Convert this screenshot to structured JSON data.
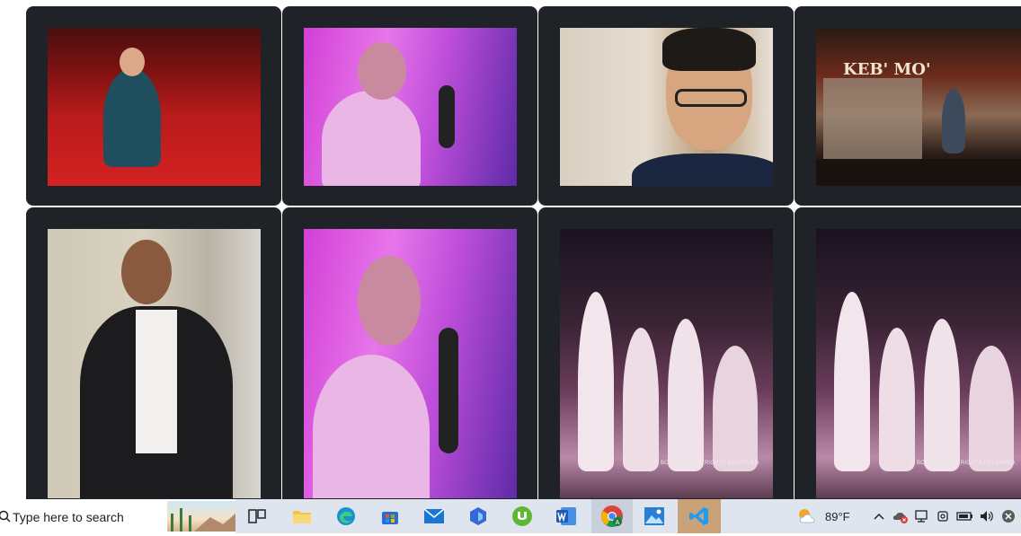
{
  "gallery": {
    "row1": [
      {
        "name": "theater-seats-photo"
      },
      {
        "name": "singer-studio-photo"
      },
      {
        "name": "glasses-portrait-photo"
      },
      {
        "name": "stage-performance-photo",
        "sign": "KEB' MO'"
      }
    ],
    "row2": [
      {
        "name": "smiling-man-photo"
      },
      {
        "name": "singer-studio-photo-2"
      },
      {
        "name": "dance-performance-photo",
        "watermark": "© BCCL 2023. ALL RIGHTS RESERVED."
      },
      {
        "name": "dance-performance-photo-2",
        "watermark": "© BCCL 2023. ALL RIGHTS RESERVED."
      }
    ]
  },
  "taskbar": {
    "search_placeholder": "Type here to search",
    "icons": [
      "task-view-icon",
      "file-explorer-icon",
      "edge-icon",
      "store-icon",
      "mail-icon",
      "copilot-icon",
      "utorrent-icon",
      "word-icon",
      "chrome-icon",
      "photos-icon",
      "vscode-icon"
    ],
    "weather": "89°F",
    "accent_colors": {
      "taskbar": "#dfe5ef",
      "card": "#1f2226"
    }
  }
}
